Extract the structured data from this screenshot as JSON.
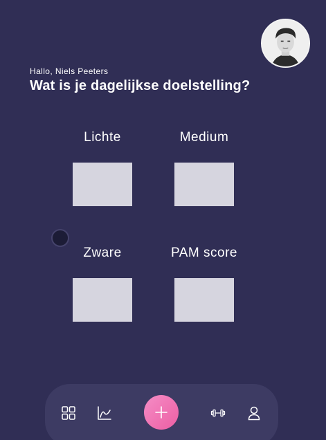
{
  "header": {
    "greeting": "Hallo, Niels Peeters",
    "title": "Wat is je dagelijkse doelstelling?"
  },
  "goals": [
    {
      "label": "Lichte",
      "value": ""
    },
    {
      "label": "Medium",
      "value": ""
    },
    {
      "label": "Zware",
      "value": ""
    },
    {
      "label": "PAM score",
      "value": ""
    }
  ],
  "nav": {
    "items": [
      {
        "icon": "grid-icon"
      },
      {
        "icon": "chart-line-icon"
      },
      {
        "icon": "plus-icon"
      },
      {
        "icon": "dumbbell-icon"
      },
      {
        "icon": "user-icon"
      }
    ]
  },
  "colors": {
    "background": "#302e55",
    "navbar": "#3d3b63",
    "accent": "#ec5ea3",
    "box": "#d6d5df"
  }
}
